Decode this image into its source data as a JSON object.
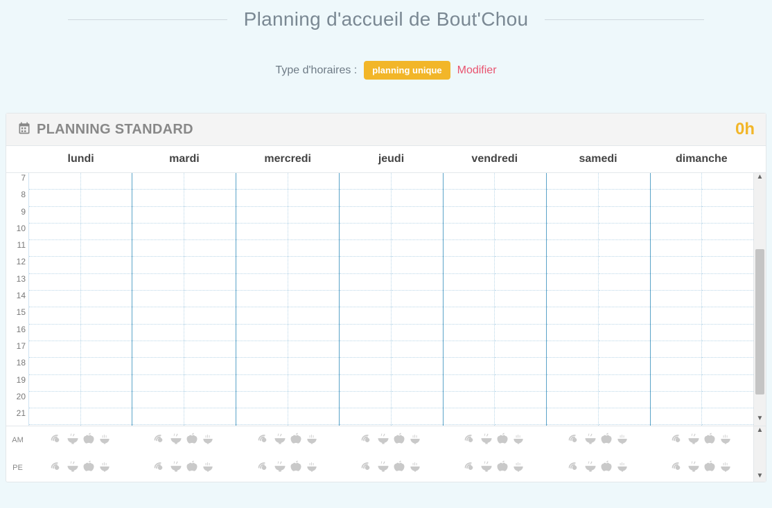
{
  "page": {
    "title": "Planning d'accueil de Bout'Chou"
  },
  "schedule_type": {
    "label": "Type d'horaires :",
    "badge": "planning unique",
    "modify": "Modifier"
  },
  "panel": {
    "title": "PLANNING STANDARD",
    "total_hours": "0h"
  },
  "days": [
    "lundi",
    "mardi",
    "mercredi",
    "jeudi",
    "vendredi",
    "samedi",
    "dimanche"
  ],
  "hours": [
    "7",
    "8",
    "9",
    "10",
    "11",
    "12",
    "13",
    "14",
    "15",
    "16",
    "17",
    "18",
    "19",
    "20",
    "21"
  ],
  "meal_rows": [
    "AM",
    "PE"
  ],
  "meal_icons": [
    "croissant-icon",
    "bowl-icon",
    "apple-icon",
    "soup-icon"
  ]
}
